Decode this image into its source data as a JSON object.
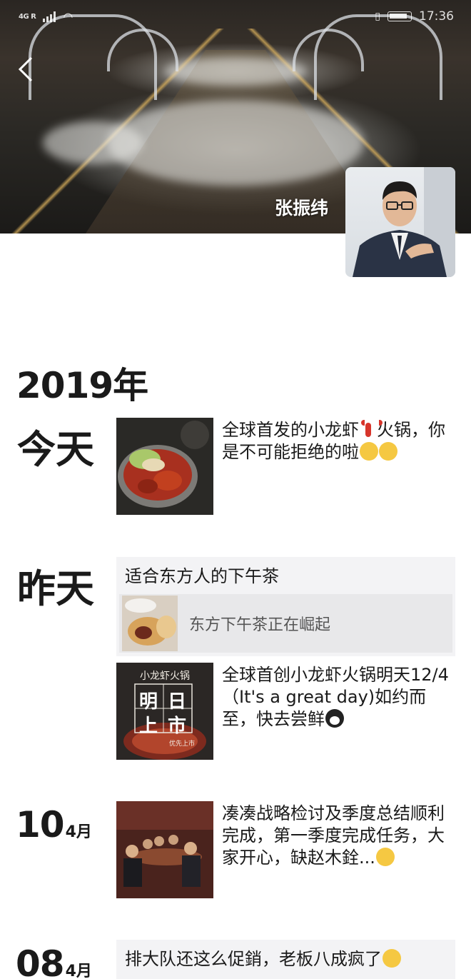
{
  "status_bar": {
    "network": "4G R",
    "time": "17:36"
  },
  "header": {
    "profile_name": "张振纬"
  },
  "timeline": {
    "year": "2019年",
    "posts": [
      {
        "day_label": "今天",
        "text": "全球首发的小龙虾",
        "text_after_emoji": "火锅，你是不可能拒绝的啦"
      },
      {
        "day_label": "昨天",
        "share_title": "适合东方人的下午茶",
        "share_desc": "东方下午茶正在崛起"
      },
      {
        "text": "全球首创小龙虾火锅明天12/4（It's a great day)如约而至，快去尝鲜",
        "thumb_caption_top": "小龙虾火锅",
        "thumb_caption_big": [
          "明",
          "日",
          "上",
          "市"
        ],
        "thumb_caption_bottom": "优先上市"
      },
      {
        "date_day": "10",
        "date_month": "4月",
        "text": "凑凑战略检讨及季度总结顺利完成，第一季度完成任务，大家开心，缺赵木銓..."
      },
      {
        "date_day": "08",
        "date_month": "4月",
        "share_title": "排大队还这么促銷，老板八成疯了"
      }
    ]
  }
}
